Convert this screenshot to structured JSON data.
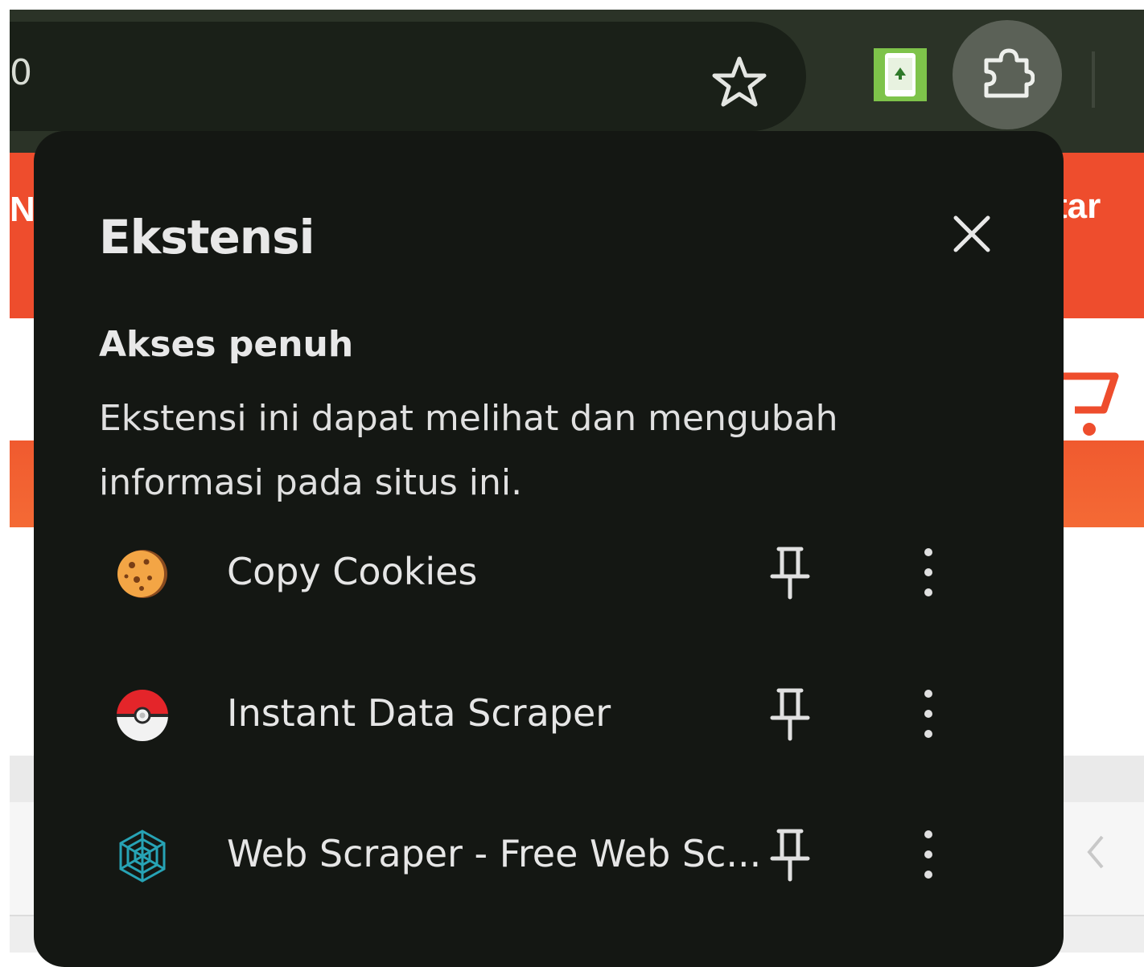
{
  "toolbar": {
    "url_partial": "0",
    "icons": [
      "star-icon",
      "extension-green-icon",
      "puzzle-icon"
    ]
  },
  "background_page": {
    "header_left_partial": "N",
    "header_right_partial": "tar",
    "icons": [
      "cart-icon",
      "chevron-left-icon"
    ]
  },
  "popup": {
    "title": "Ekstensi",
    "section": {
      "title": "Akses penuh",
      "description": "Ekstensi ini dapat melihat dan mengubah informasi pada situs ini."
    },
    "extensions": [
      {
        "name": "Copy Cookies",
        "icon": "cookie-icon"
      },
      {
        "name": "Instant Data Scraper",
        "icon": "pokeball-icon"
      },
      {
        "name": "Web Scraper - Free Web Sc...",
        "icon": "spiderweb-icon"
      }
    ]
  },
  "colors": {
    "toolbar_bg": "#2b3327",
    "popup_bg": "#141713",
    "accent_orange": "#ee4d2d"
  }
}
